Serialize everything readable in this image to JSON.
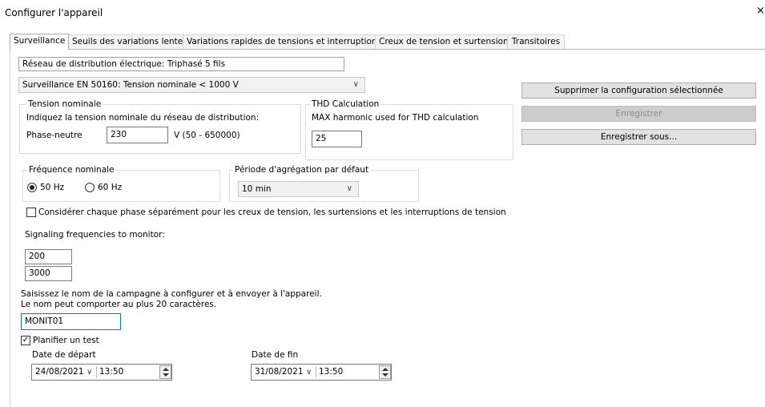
{
  "window": {
    "title": "Configurer l'appareil",
    "close_glyph": "×"
  },
  "tabs": [
    {
      "label": "Surveillance",
      "active": true
    },
    {
      "label": "Seuils des variations lentes"
    },
    {
      "label": "Variations rapides de tensions et interruptions"
    },
    {
      "label": "Creux de tension et surtensions"
    },
    {
      "label": "Transitoires"
    }
  ],
  "network": {
    "value": "Réseau de distribution électrique: Triphasé 5 fils"
  },
  "monitoring_mode": {
    "value": "Surveillance EN 50160: Tension nominale < 1000 V"
  },
  "nominal_voltage": {
    "legend": "Tension nominale",
    "instruction": "Indiquez la tension nominale du réseau de distribution:",
    "label": "Phase-neutre",
    "value": "230",
    "range": "V (50 - 650000)"
  },
  "thd": {
    "legend": "THD Calculation",
    "label": "MAX harmonic used for THD calculation",
    "value": "25"
  },
  "frequency": {
    "legend": "Fréquence nominale",
    "options": [
      {
        "label": "50 Hz",
        "selected": true
      },
      {
        "label": "60 Hz",
        "selected": false
      }
    ]
  },
  "aggregation": {
    "legend": "Période d'agrégation par défaut",
    "value": "10 min"
  },
  "per_phase": {
    "checked": false,
    "label": "Considérer chaque phase séparément pour les creux de tension, les surtensions et les interruptions de tension"
  },
  "signaling": {
    "label": "Signaling frequencies to monitor:",
    "values": [
      "200",
      "3000"
    ]
  },
  "campaign": {
    "line1": "Saisissez le nom de la campagne à configurer et à envoyer à l'appareil.",
    "line2": "Le nom peut comporter au plus 20 caractères.",
    "value": "MONIT01"
  },
  "schedule": {
    "checked": true,
    "label": "Planifier un test",
    "start": {
      "label": "Date de départ",
      "date": "24/08/2021",
      "time": "13:50"
    },
    "end": {
      "label": "Date de fin",
      "date": "31/08/2021",
      "time": "13:50"
    }
  },
  "buttons": {
    "delete": "Supprimer la configuration sélectionnée",
    "save": "Enregistrer",
    "save_as": "Enregistrer sous..."
  },
  "icons": {
    "combo_arrow": "chevron-down-icon",
    "radio_on": "radio-selected-icon",
    "check": "checkmark-icon"
  },
  "check_glyph": "✓",
  "chevron_glyph": "∨"
}
